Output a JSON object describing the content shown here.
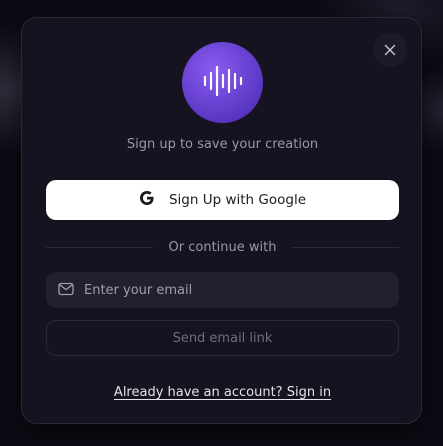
{
  "modal": {
    "subtitle": "Sign up to save your creation",
    "google_button_label": "Sign Up with Google",
    "divider_text": "Or continue with",
    "email": {
      "placeholder": "Enter your email",
      "value": ""
    },
    "send_button_label": "Send email link",
    "signin_link": "Already have an account? Sign in"
  },
  "icons": {
    "close": "close-icon",
    "logo": "waveform-icon",
    "google": "google-icon",
    "mail": "mail-icon"
  },
  "colors": {
    "accent": "#6b43d6",
    "background": "#0d0b14",
    "modal": "#151320"
  }
}
